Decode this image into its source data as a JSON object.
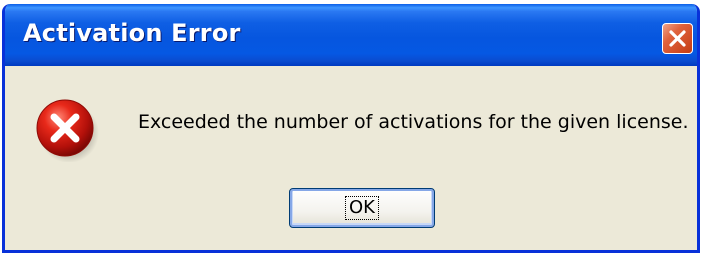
{
  "window": {
    "title": "Activation Error",
    "close_icon": "close-icon",
    "accent_color": "#0558e3",
    "close_color": "#e0623c"
  },
  "dialog": {
    "icon": "error-icon",
    "message": "Exceeded the number of activations for the given license.",
    "ok_label": "OK"
  }
}
